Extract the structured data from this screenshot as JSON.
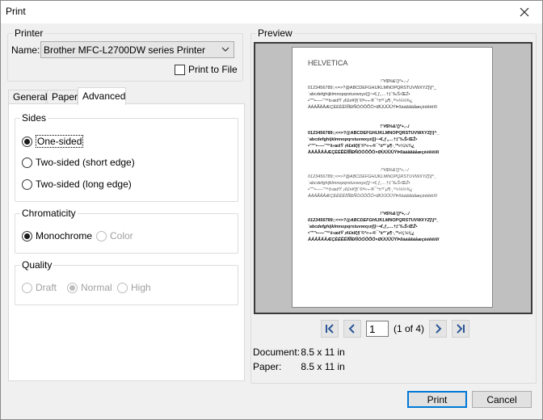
{
  "window": {
    "title": "Print"
  },
  "printer": {
    "group_label": "Printer",
    "name_label": "Name:",
    "selected": "Brother MFC-L2700DW series Printer",
    "print_to_file_label": "Print to File",
    "print_to_file_checked": false
  },
  "tabs": [
    {
      "label": "General"
    },
    {
      "label": "Paper"
    },
    {
      "label": "Advanced",
      "active": true
    }
  ],
  "sides": {
    "label": "Sides",
    "options": [
      {
        "label": "One-sided",
        "checked": true
      },
      {
        "label": "Two-sided (short edge)",
        "checked": false
      },
      {
        "label": "Two-sided (long edge)",
        "checked": false
      }
    ]
  },
  "chromaticity": {
    "label": "Chromaticity",
    "options": [
      {
        "label": "Monochrome",
        "checked": true,
        "enabled": true
      },
      {
        "label": "Color",
        "checked": false,
        "enabled": false
      }
    ]
  },
  "quality": {
    "label": "Quality",
    "options": [
      {
        "label": "Draft",
        "checked": false,
        "enabled": false
      },
      {
        "label": "Normal",
        "checked": true,
        "enabled": false
      },
      {
        "label": "High",
        "checked": false,
        "enabled": false
      }
    ]
  },
  "preview": {
    "label": "Preview",
    "page_heading": "HELVETICA",
    "font_lines": [
      "!\"#$%&'()*+,-./",
      "0123456789:;<=>?@ABCDEFGHIJKLMNOPQRSTUVWXYZ[\\]^_",
      "`abcdefghijklmnopqrstuvwxyz{|}~•€‚ƒ„…†‡ˆ‰Š‹ŒŽ•",
      "•''\"\"•–—˜™š›œžŸ ¡¢£¤¥¦§¨©ª«¬-®¯°±²³´µ¶·¸¹º»¼½¾¿",
      "ÀÁÂÃÄÅÆÇÈÉÊËÌÍÎÏÐÑÒÓÔÕÖ×ØÙÚÛÜÝÞßàáâãäåæçèéêëìíîï"
    ],
    "page_input": "1",
    "page_count_text": "(1 of 4)",
    "document_label": "Document:",
    "document_size": "8.5 x 11 in",
    "paper_label": "Paper:",
    "paper_size": "8.5 x 11 in"
  },
  "buttons": {
    "print": "Print",
    "cancel": "Cancel"
  },
  "icons": {
    "close": "close-icon",
    "dropdown": "chevron-down-icon",
    "first": "first-page-icon",
    "prev": "previous-page-icon",
    "next": "next-page-icon",
    "last": "last-page-icon"
  },
  "colors": {
    "accent": "#0078d7",
    "nav_icon": "#2b5797"
  }
}
